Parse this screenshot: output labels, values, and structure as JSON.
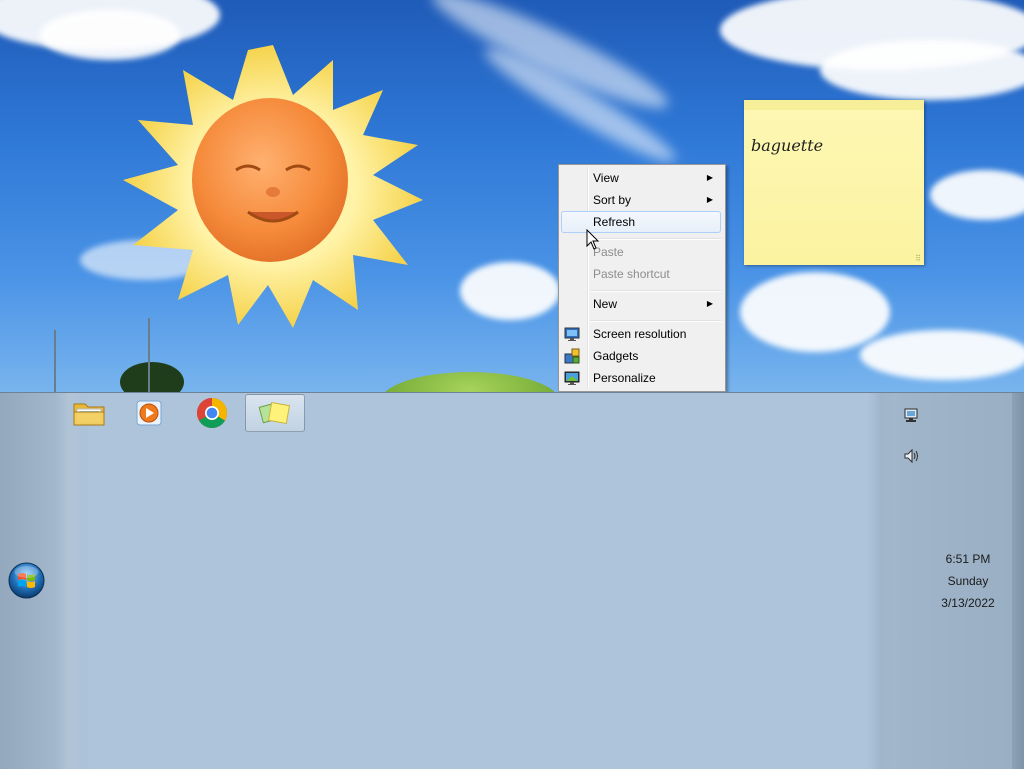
{
  "sticky_note": {
    "text": "baguette"
  },
  "context_menu": {
    "items": [
      {
        "label": "View",
        "has_submenu": true,
        "enabled": true
      },
      {
        "label": "Sort by",
        "has_submenu": true,
        "enabled": true
      },
      {
        "label": "Refresh",
        "has_submenu": false,
        "enabled": true,
        "highlighted": true
      },
      {
        "label": "Paste",
        "has_submenu": false,
        "enabled": false
      },
      {
        "label": "Paste shortcut",
        "has_submenu": false,
        "enabled": false
      },
      {
        "label": "New",
        "has_submenu": true,
        "enabled": true
      },
      {
        "label": "Screen resolution",
        "icon": "screen-resolution-icon",
        "enabled": true
      },
      {
        "label": "Gadgets",
        "icon": "gadgets-icon",
        "enabled": true
      },
      {
        "label": "Personalize",
        "icon": "personalize-icon",
        "enabled": true
      }
    ]
  },
  "taskbar": {
    "pinned": [
      {
        "icon": "file-explorer-icon",
        "active": false
      },
      {
        "icon": "media-player-icon",
        "active": false
      },
      {
        "icon": "chrome-icon",
        "active": false
      },
      {
        "icon": "sticky-notes-icon",
        "active": true
      }
    ],
    "tray": [
      {
        "icon": "network-icon"
      },
      {
        "icon": "volume-icon"
      }
    ],
    "clock": {
      "time": "6:51 PM",
      "day": "Sunday",
      "date": "3/13/2022"
    }
  },
  "colors": {
    "menu_background": "#f0f0f0",
    "menu_highlight_border": "#aecff7",
    "sticky_yellow": "#fcf3a0",
    "taskbar": "#adc4db"
  }
}
